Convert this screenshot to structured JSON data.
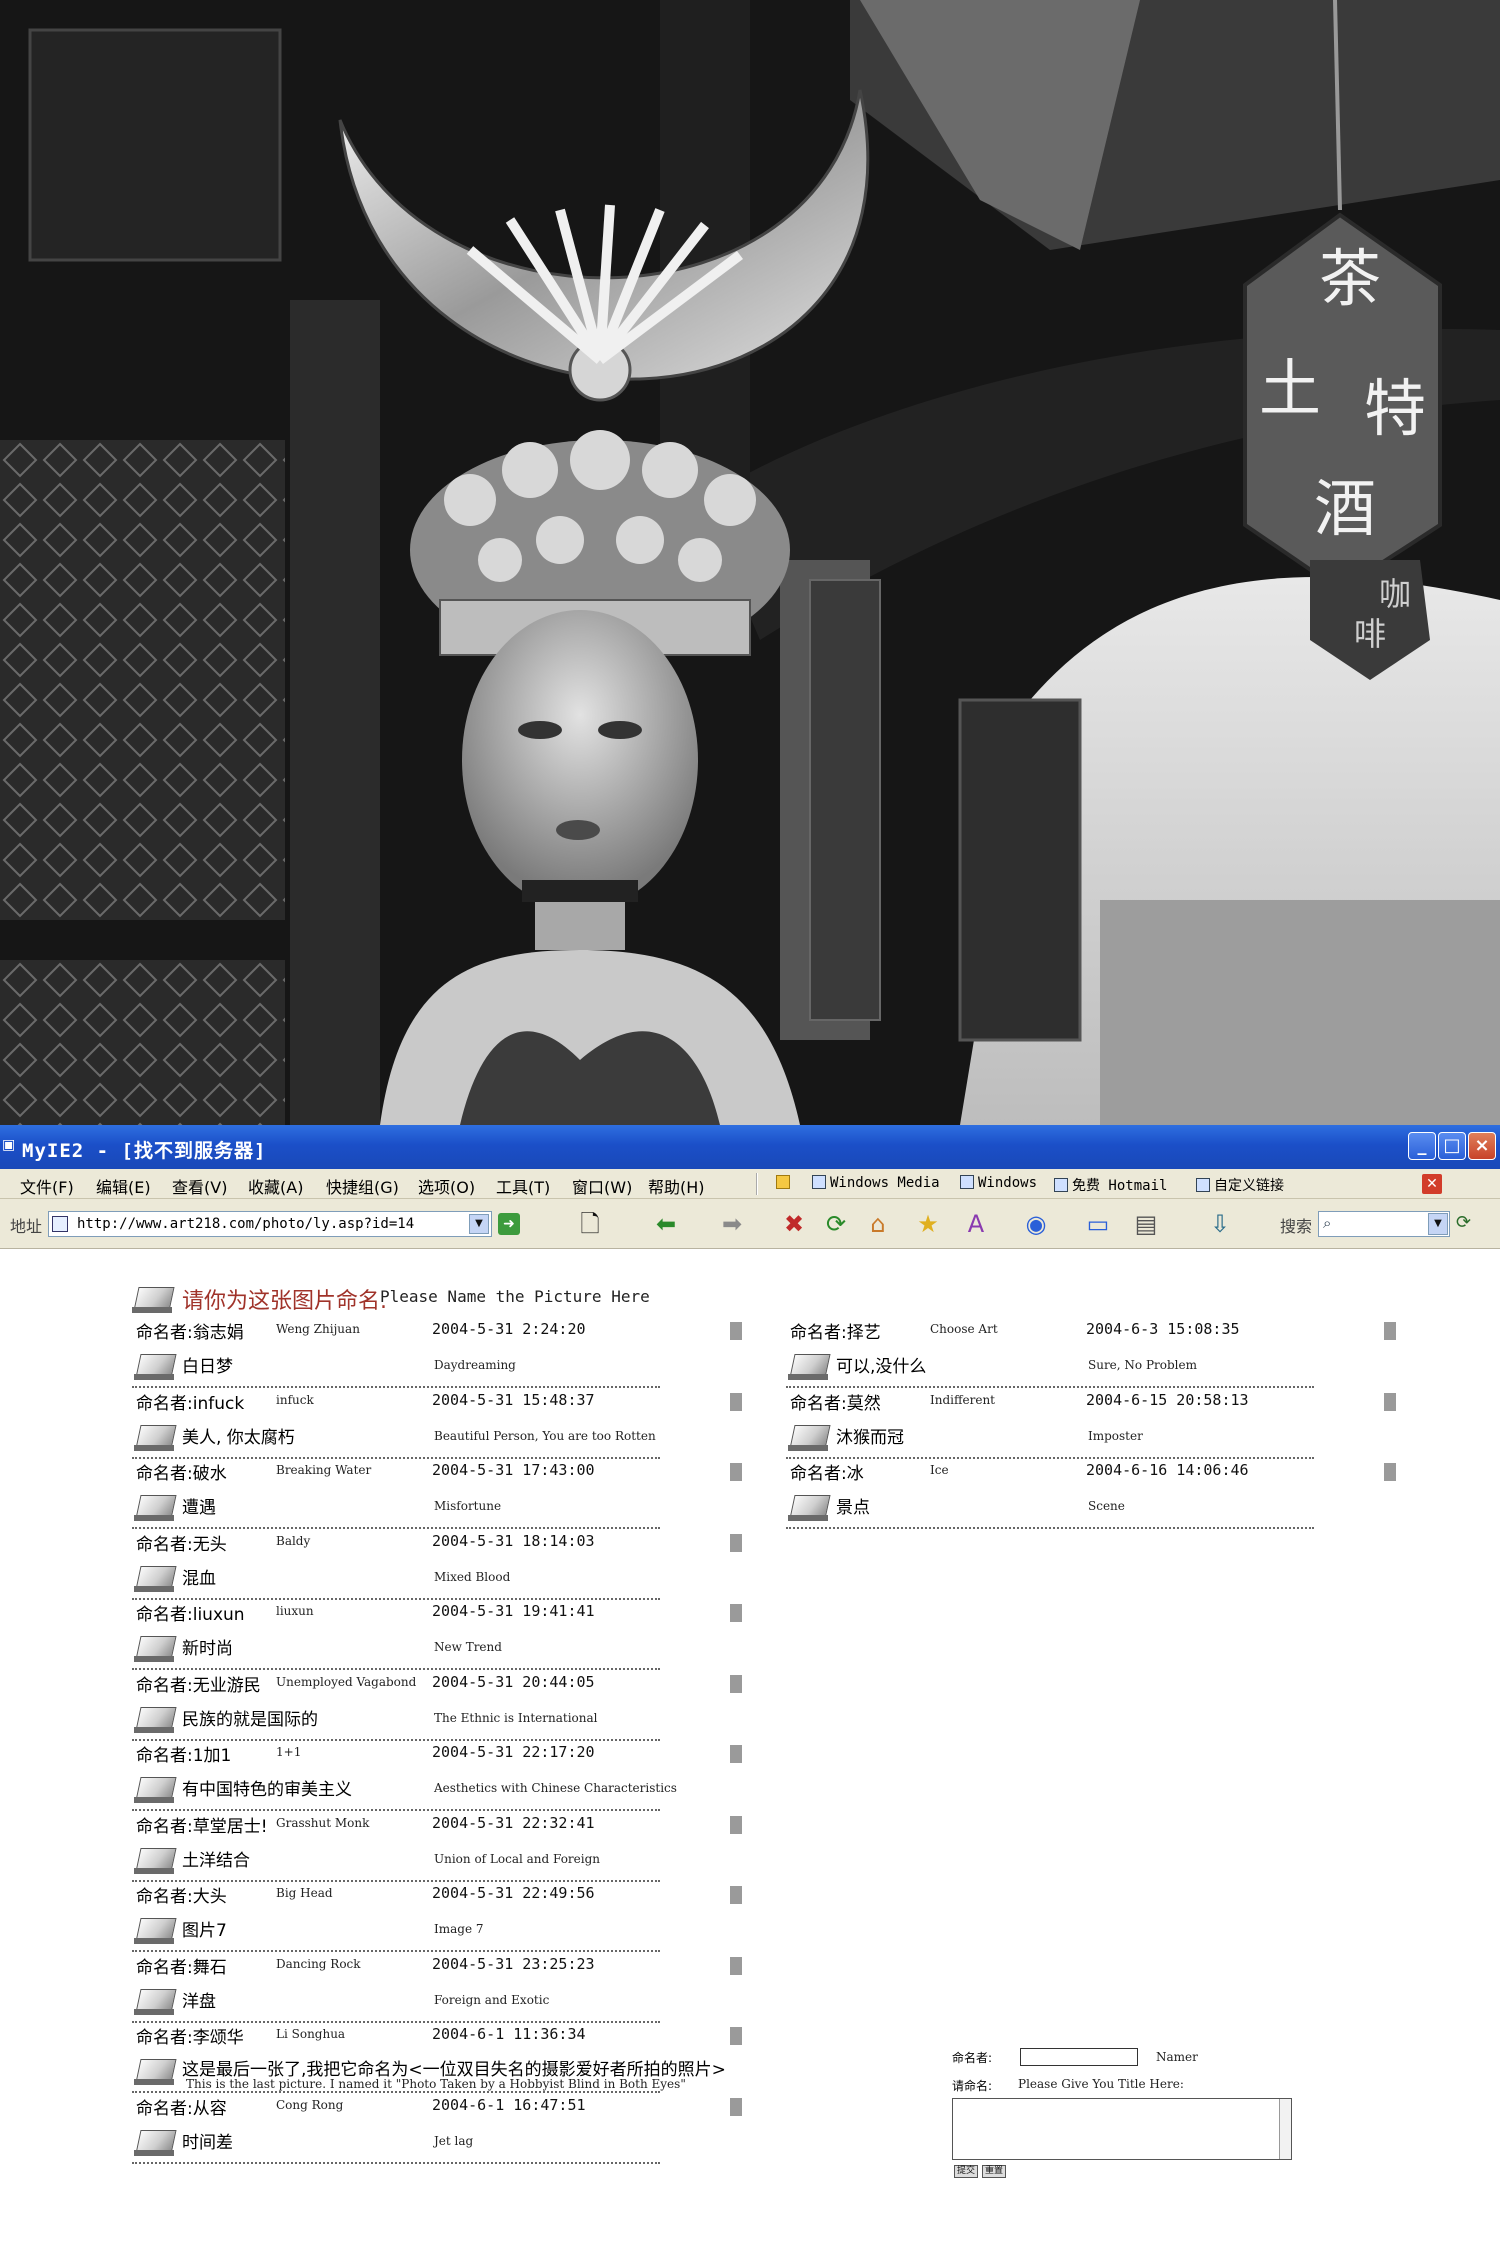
{
  "photo": {
    "sign_characters": [
      "茶",
      "土",
      "特",
      "酒"
    ],
    "second_sign_characters": [
      "咖",
      "啡"
    ]
  },
  "window": {
    "title": "MyIE2 - [找不到服务器]",
    "controls": {
      "minimize": "_",
      "maximize": "□",
      "close": "×"
    }
  },
  "menu": {
    "items": [
      "文件(F)",
      "编辑(E)",
      "查看(V)",
      "收藏(A)",
      "快捷组(G)",
      "选项(O)",
      "工具(T)",
      "窗口(W)",
      "帮助(H)"
    ],
    "links": [
      "Windows Media",
      "Windows",
      "免费 Hotmail",
      "自定义链接"
    ]
  },
  "toolbar": {
    "address_label": "地址",
    "url": "http://www.art218.com/photo/ly.asp?id=14",
    "search_label": "搜索"
  },
  "page": {
    "heading_cn": "请你为这张图片命名.",
    "heading_en": "Please Name the Picture Here",
    "namer_label": "命名者:",
    "left_entries": [
      {
        "name_cn": "翁志娟",
        "name_en": "Weng Zhijuan",
        "time": "2004-5-31 2:24:20",
        "title_cn": "白日梦",
        "title_en": "Daydreaming"
      },
      {
        "name_cn": "infuck",
        "name_en": "infuck",
        "time": "2004-5-31 15:48:37",
        "title_cn": "美人, 你太腐朽",
        "title_en": "Beautiful Person, You are too Rotten"
      },
      {
        "name_cn": "破水",
        "name_en": "Breaking Water",
        "time": "2004-5-31 17:43:00",
        "title_cn": "遭遇",
        "title_en": "Misfortune"
      },
      {
        "name_cn": "无头",
        "name_en": "Baldy",
        "time": "2004-5-31 18:14:03",
        "title_cn": "混血",
        "title_en": "Mixed Blood"
      },
      {
        "name_cn": "liuxun",
        "name_en": "liuxun",
        "time": "2004-5-31 19:41:41",
        "title_cn": "新时尚",
        "title_en": "New Trend"
      },
      {
        "name_cn": "无业游民",
        "name_en": "Unemployed Vagabond",
        "time": "2004-5-31 20:44:05",
        "title_cn": "民族的就是国际的",
        "title_en": "The Ethnic is International"
      },
      {
        "name_cn": "1加1",
        "name_en": "1+1",
        "time": "2004-5-31 22:17:20",
        "title_cn": "有中国特色的审美主义",
        "title_en": "Aesthetics with Chinese Characteristics"
      },
      {
        "name_cn": "草堂居士!",
        "name_en": "Grasshut Monk",
        "time": "2004-5-31 22:32:41",
        "title_cn": "土洋结合",
        "title_en": "Union of Local and Foreign"
      },
      {
        "name_cn": "大头",
        "name_en": "Big Head",
        "time": "2004-5-31 22:49:56",
        "title_cn": "图片7",
        "title_en": "Image 7"
      },
      {
        "name_cn": "舞石",
        "name_en": "Dancing Rock",
        "time": "2004-5-31 23:25:23",
        "title_cn": "洋盘",
        "title_en": "Foreign and Exotic"
      },
      {
        "name_cn": "李颂华",
        "name_en": "Li Songhua",
        "time": "2004-6-1 11:36:34",
        "title_cn": "这是最后一张了,我把它命名为<一位双目失名的摄影爱好者所拍的照片>",
        "title_en": "This is the last picture. I named it \"Photo Taken by a Hobbyist Blind in Both Eyes\""
      },
      {
        "name_cn": "从容",
        "name_en": "Cong Rong",
        "time": "2004-6-1 16:47:51",
        "title_cn": "时间差",
        "title_en": "Jet lag"
      }
    ],
    "right_entries": [
      {
        "name_cn": "择艺",
        "name_en": "Choose Art",
        "time": "2004-6-3 15:08:35",
        "title_cn": "可以,没什么",
        "title_en": "Sure, No Problem"
      },
      {
        "name_cn": "莫然",
        "name_en": "Indifferent",
        "time": "2004-6-15 20:58:13",
        "title_cn": "沐猴而冠",
        "title_en": "Imposter"
      },
      {
        "name_cn": "冰",
        "name_en": "Ice",
        "time": "2004-6-16 14:06:46",
        "title_cn": "景点",
        "title_en": "Scene"
      }
    ],
    "form": {
      "namer_label": "命名者:",
      "namer_en": "Namer",
      "title_label": "请命名:",
      "title_en": "Please Give You Title Here:",
      "submit": "提交",
      "reset": "重置"
    }
  }
}
